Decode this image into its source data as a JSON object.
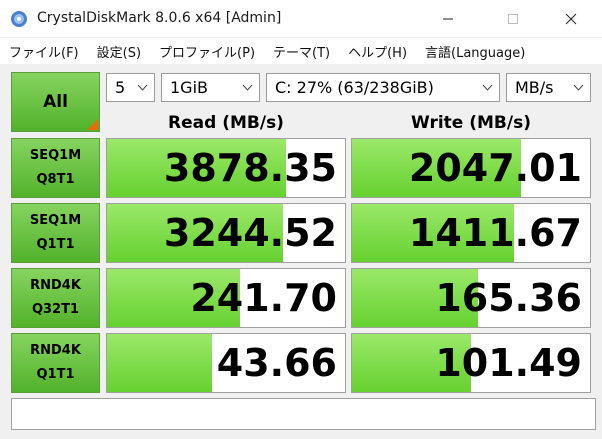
{
  "window": {
    "title": "CrystalDiskMark 8.0.6 x64 [Admin]"
  },
  "menu": [
    {
      "label": "ファイル(F)"
    },
    {
      "label": "設定(S)"
    },
    {
      "label": "プロファイル(P)"
    },
    {
      "label": "テーマ(T)"
    },
    {
      "label": "ヘルプ(H)"
    },
    {
      "label": "言語(Language)"
    }
  ],
  "controls": {
    "all_label": "All",
    "count": "5",
    "size": "1GiB",
    "drive": "C: 27% (63/238GiB)",
    "unit": "MB/s"
  },
  "headers": {
    "read": "Read (MB/s)",
    "write": "Write (MB/s)"
  },
  "rows": [
    {
      "line1": "SEQ1M",
      "line2": "Q8T1",
      "read": "3878.35",
      "write": "2047.01",
      "read_fill": 0.75,
      "write_fill": 0.71
    },
    {
      "line1": "SEQ1M",
      "line2": "Q1T1",
      "read": "3244.52",
      "write": "1411.67",
      "read_fill": 0.74,
      "write_fill": 0.68
    },
    {
      "line1": "RND4K",
      "line2": "Q32T1",
      "read": "241.70",
      "write": "165.36",
      "read_fill": 0.56,
      "write_fill": 0.53
    },
    {
      "line1": "RND4K",
      "line2": "Q1T1",
      "read": "43.66",
      "write": "101.49",
      "read_fill": 0.44,
      "write_fill": 0.5
    }
  ],
  "comment": ""
}
